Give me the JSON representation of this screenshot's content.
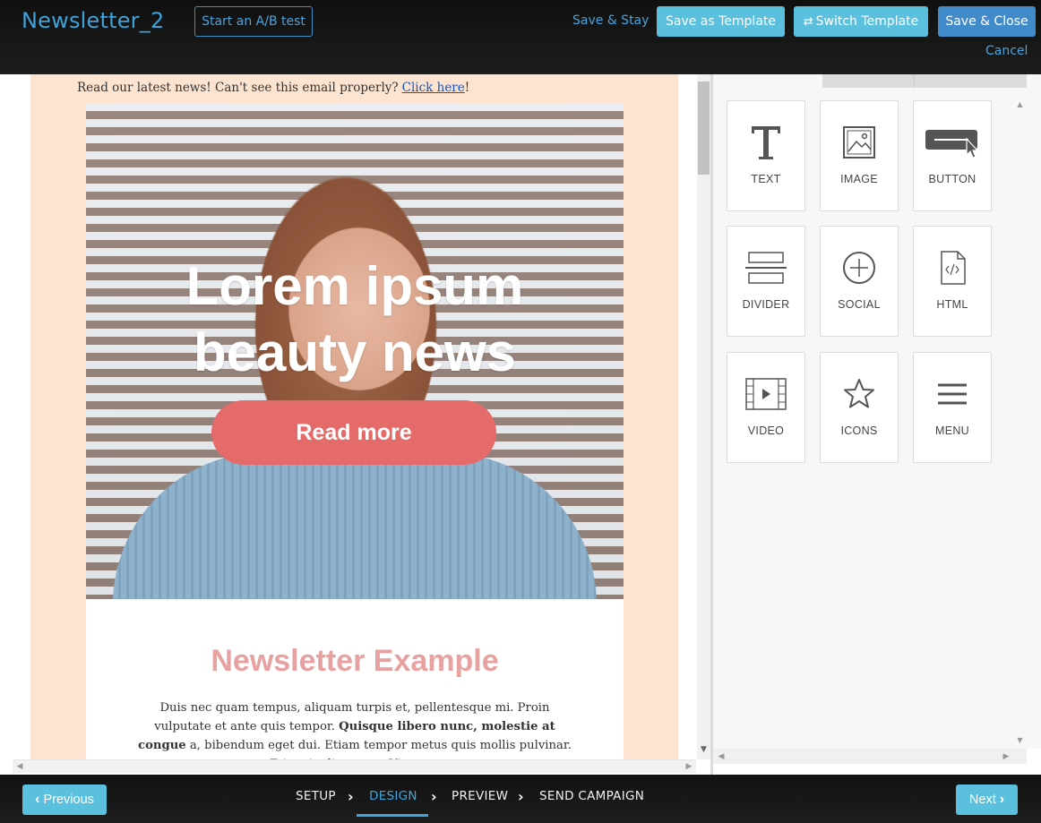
{
  "header": {
    "title": "Newsletter_2",
    "ab_test_label": "Start an A/B test",
    "save_stay_label": "Save & Stay",
    "save_template_label": "Save as Template",
    "switch_template_label": "Switch Template",
    "save_close_label": "Save & Close",
    "cancel_label": "Cancel"
  },
  "email": {
    "preheader_text": "Read our latest news! Can't see this email properly?",
    "preheader_link": "Click here",
    "preheader_suffix": "!",
    "hero_title_line1": "Lorem ipsum",
    "hero_title_line2": "beauty news",
    "hero_button": "Read more",
    "section_title": "Newsletter Example",
    "body_part1": "Duis nec quam tempus, aliquam turpis et, pellentesque mi. Proin vulputate et ante quis tempor.",
    "body_bold": "Quisque libero nunc, molestie at congue",
    "body_part2": "a, bibendum eget dui. Etiam tempor metus quis mollis pulvinar. Etiam in diam erat. Vivamus"
  },
  "blocks": [
    {
      "label": "TEXT",
      "icon": "text-icon"
    },
    {
      "label": "IMAGE",
      "icon": "image-icon"
    },
    {
      "label": "BUTTON",
      "icon": "button-icon"
    },
    {
      "label": "DIVIDER",
      "icon": "divider-icon"
    },
    {
      "label": "SOCIAL",
      "icon": "social-icon"
    },
    {
      "label": "HTML",
      "icon": "html-icon"
    },
    {
      "label": "VIDEO",
      "icon": "video-icon"
    },
    {
      "label": "ICONS",
      "icon": "star-icon"
    },
    {
      "label": "MENU",
      "icon": "menu-icon"
    }
  ],
  "footer": {
    "previous_label": "Previous",
    "next_label": "Next",
    "steps": [
      "SETUP",
      "DESIGN",
      "PREVIEW",
      "SEND CAMPAIGN"
    ],
    "active_step": "DESIGN"
  },
  "colors": {
    "accent": "#5bc0de",
    "primary": "#428bca",
    "email_background": "#fce4d0",
    "hero_button": "#e56b6b",
    "section_title": "#e8a1a1"
  }
}
